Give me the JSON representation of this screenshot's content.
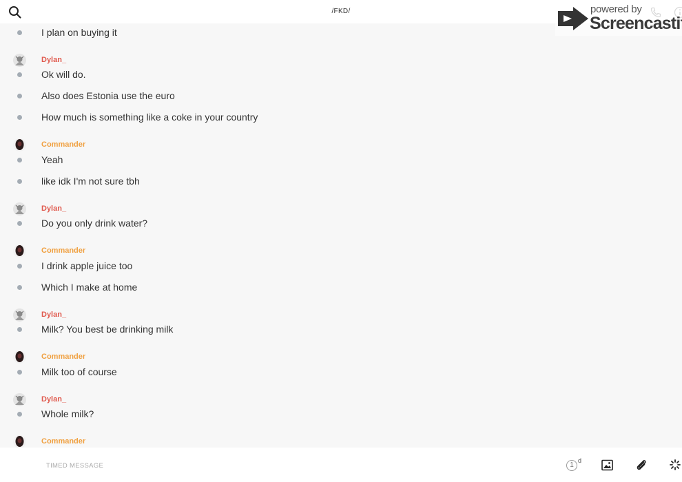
{
  "header": {
    "title": "/FKD/"
  },
  "watermark": {
    "powered_by": "powered by",
    "brand": "Screencastify"
  },
  "messages": [
    {
      "text": "I plan on buying it"
    },
    {
      "author": "Dylan_",
      "text": "Ok will do."
    },
    {
      "text": "Also does Estonia use the euro"
    },
    {
      "text": "How much is something like a coke in your country"
    },
    {
      "author": "Commander",
      "text": "Yeah"
    },
    {
      "text": "like idk I'm not sure tbh"
    },
    {
      "author": "Dylan_",
      "text": "Do you only drink water?"
    },
    {
      "author": "Commander",
      "text": "I drink apple juice too"
    },
    {
      "text": "Which I make at home"
    },
    {
      "author": "Dylan_",
      "text": "Milk? You best be drinking milk"
    },
    {
      "author": "Commander",
      "text": "Milk too of course"
    },
    {
      "author": "Dylan_",
      "text": "Whole milk?"
    },
    {
      "author": "Commander"
    }
  ],
  "composer": {
    "placeholder": "TIMED MESSAGE",
    "timer_value": "1",
    "timer_unit": "d"
  },
  "icons": {
    "search": "search-icon",
    "call": "phone-icon",
    "info": "info-icon",
    "image": "image-icon",
    "attach": "paperclip-icon",
    "more": "spinner-icon"
  },
  "colors": {
    "dylan": "#e05a4e",
    "commander": "#f0a040",
    "bullet": "#a4acb4"
  }
}
